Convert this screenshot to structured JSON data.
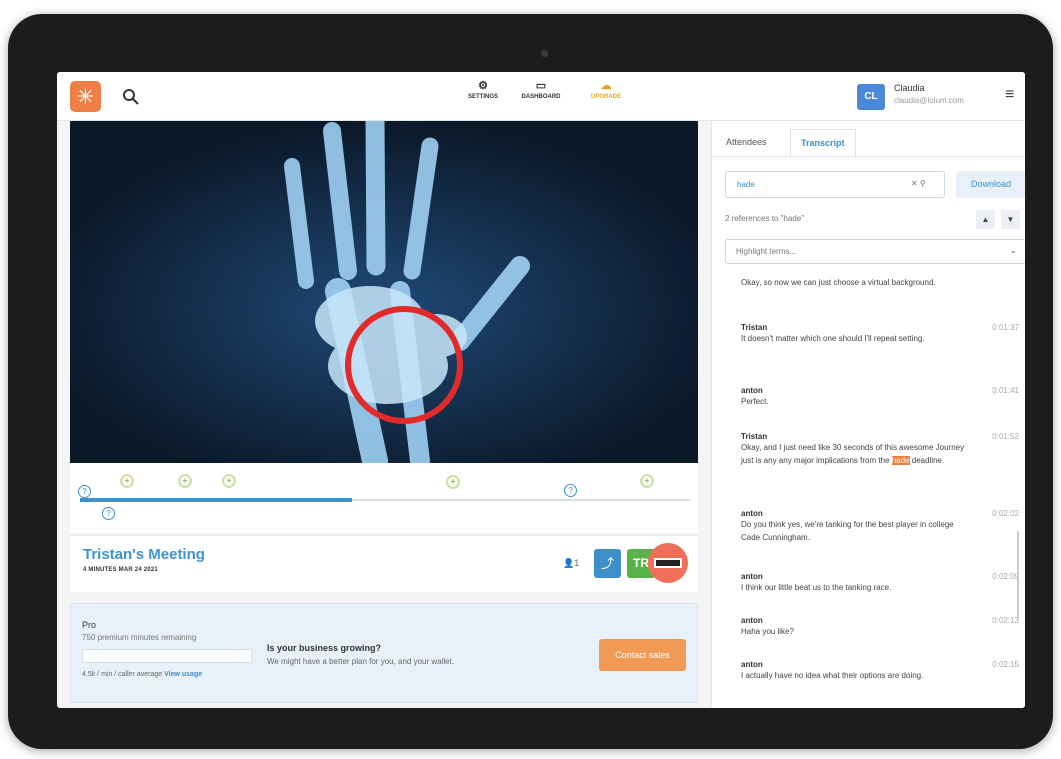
{
  "header": {
    "nav": [
      {
        "label": "SETTINGS",
        "icon": "gear-icon"
      },
      {
        "label": "DASHBOARD",
        "icon": "calendar-icon"
      },
      {
        "label": "UPGRADE",
        "icon": "cloud-upload-icon",
        "color": "#e2a622"
      }
    ],
    "user": {
      "initials": "CL",
      "name": "Claudia",
      "email": "claudia@lolum.com"
    }
  },
  "meeting": {
    "title": "Tristan's Meeting",
    "meta": "4 MINUTES   MAR 24 2021",
    "attendee_count": "1",
    "badge": "TR"
  },
  "plan": {
    "name": "Pro",
    "remaining": "750 premium minutes remaining",
    "usage_text": "4.5k / min / caller average",
    "usage_link": "View usage",
    "promo_title": "Is your business growing?",
    "promo_text": "We might have a better plan for you, and your wallet.",
    "cta": "Contact sales"
  },
  "panel": {
    "tabs": [
      "Attendees",
      "Transcript"
    ],
    "active_tab": "Transcript",
    "search": {
      "value": "hade",
      "placeholder": "Search"
    },
    "download_label": "Download",
    "references": "2 references to \"hade\"",
    "highlight_placeholder": "Highlight terms...",
    "entries": [
      {
        "speaker": "",
        "time": "",
        "text": "Okay, so now we can just choose a virtual background."
      },
      {
        "speaker": "Tristan",
        "time": "0:01:37",
        "text": "It doesn't matter which one should I'll repeat setting."
      },
      {
        "speaker": "anton",
        "time": "0:01:41",
        "text": "Perfect."
      },
      {
        "speaker": "Tristan",
        "time": "0:01:52",
        "text_before": "Okay, and I just need like 30 seconds of this awesome Journey just is any any major implications from the ",
        "highlight": "hade",
        "text_after": " deadline."
      },
      {
        "speaker": "anton",
        "time": "0:02:02",
        "text": "Do you think yes, we're tanking for the best player in college Cade Cunningham."
      },
      {
        "speaker": "anton",
        "time": "0:02:09",
        "text": "I think our little beat us to the tanking race."
      },
      {
        "speaker": "anton",
        "time": "0:02:12",
        "text": "Haha you like?"
      },
      {
        "speaker": "anton",
        "time": "0:02:15",
        "text": "I actually have no idea what their options are doing."
      }
    ]
  },
  "colors": {
    "accent": "#3d8fc9",
    "brand": "#f07f45",
    "highlight": "#f07f3a",
    "success": "#59b34a"
  }
}
